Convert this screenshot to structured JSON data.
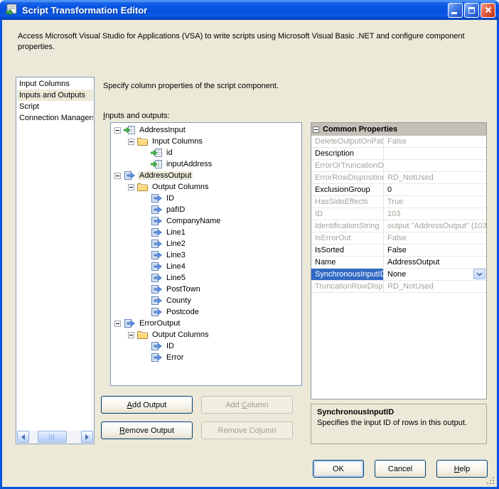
{
  "window": {
    "title": "Script Transformation Editor",
    "description": "Access Microsoft Visual Studio for Applications (VSA) to write scripts using Microsoft Visual Basic .NET and configure component properties."
  },
  "sidebar": {
    "items": [
      {
        "label": "Input Columns",
        "selected": false
      },
      {
        "label": "Inputs and Outputs",
        "selected": true
      },
      {
        "label": "Script",
        "selected": false
      },
      {
        "label": "Connection Managers",
        "selected": false
      }
    ]
  },
  "main": {
    "instruction": "Specify column properties of the script component.",
    "tree_label": {
      "label": "Inputs and outputs:",
      "accel": 0
    },
    "tree": [
      {
        "label": "AddressInput",
        "depth": 0,
        "icon": "input-column",
        "expanded": true
      },
      {
        "label": "Input Columns",
        "depth": 1,
        "icon": "folder",
        "expanded": true
      },
      {
        "label": "id",
        "depth": 2,
        "icon": "input-column"
      },
      {
        "label": "inputAddress",
        "depth": 2,
        "icon": "input-column"
      },
      {
        "label": "AddressOutput",
        "depth": 0,
        "icon": "output-column",
        "expanded": true,
        "selected": true
      },
      {
        "label": "Output Columns",
        "depth": 1,
        "icon": "folder",
        "expanded": true
      },
      {
        "label": "ID",
        "depth": 2,
        "icon": "output-column"
      },
      {
        "label": "pafID",
        "depth": 2,
        "icon": "output-column"
      },
      {
        "label": "CompanyName",
        "depth": 2,
        "icon": "output-column"
      },
      {
        "label": "Line1",
        "depth": 2,
        "icon": "output-column"
      },
      {
        "label": "Line2",
        "depth": 2,
        "icon": "output-column"
      },
      {
        "label": "Line3",
        "depth": 2,
        "icon": "output-column"
      },
      {
        "label": "Line4",
        "depth": 2,
        "icon": "output-column"
      },
      {
        "label": "Line5",
        "depth": 2,
        "icon": "output-column"
      },
      {
        "label": "PostTown",
        "depth": 2,
        "icon": "output-column"
      },
      {
        "label": "County",
        "depth": 2,
        "icon": "output-column"
      },
      {
        "label": "Postcode",
        "depth": 2,
        "icon": "output-column"
      },
      {
        "label": "ErrorOutput",
        "depth": 0,
        "icon": "output-column",
        "expanded": true
      },
      {
        "label": "Output Columns",
        "depth": 1,
        "icon": "folder",
        "expanded": true
      },
      {
        "label": "ID",
        "depth": 2,
        "icon": "output-column"
      },
      {
        "label": "Error",
        "depth": 2,
        "icon": "output-column"
      }
    ],
    "buttons": [
      {
        "label": "Add Output",
        "accel": 0,
        "enabled": true
      },
      {
        "label": "Add Column",
        "accel": 4,
        "enabled": false
      },
      {
        "label": "Remove Output",
        "accel": 0,
        "enabled": true
      },
      {
        "label": "Remove Column",
        "accel": 9,
        "enabled": false
      }
    ]
  },
  "properties": {
    "category": "Common Properties",
    "rows": [
      {
        "name": "DeleteOutputOnPath",
        "value": "False",
        "state": "disabled"
      },
      {
        "name": "Description",
        "value": "",
        "state": "normal"
      },
      {
        "name": "ErrorOrTruncationOp",
        "value": "",
        "state": "disabled"
      },
      {
        "name": "ErrorRowDisposition",
        "value": "RD_NotUsed",
        "state": "disabled"
      },
      {
        "name": "ExclusionGroup",
        "value": "0",
        "state": "normal"
      },
      {
        "name": "HasSideEffects",
        "value": "True",
        "state": "disabled"
      },
      {
        "name": "ID",
        "value": "103",
        "state": "disabled"
      },
      {
        "name": "IdentificationString",
        "value": "output \"AddressOutput\" (103",
        "state": "disabled"
      },
      {
        "name": "IsErrorOut",
        "value": "False",
        "state": "disabled"
      },
      {
        "name": "IsSorted",
        "value": "False",
        "state": "normal"
      },
      {
        "name": "Name",
        "value": "AddressOutput",
        "state": "normal"
      },
      {
        "name": "SynchronousInputID",
        "value": "None",
        "state": "selected",
        "dropdown": true
      },
      {
        "name": "TruncationRowDispos",
        "value": "RD_NotUsed",
        "state": "disabled"
      }
    ],
    "help": {
      "title": "SynchronousInputID",
      "text": "Specifies the input ID of rows in this output."
    }
  },
  "footer": {
    "buttons": [
      {
        "label": "OK",
        "accel": -1,
        "default": true
      },
      {
        "label": "Cancel",
        "accel": -1
      },
      {
        "label": "Help",
        "accel": 0
      }
    ]
  },
  "colors": {
    "selection_blue": "#316AC5",
    "dialog_bg": "#ECE9D8",
    "titlebar_blue": "#0A55E2"
  }
}
